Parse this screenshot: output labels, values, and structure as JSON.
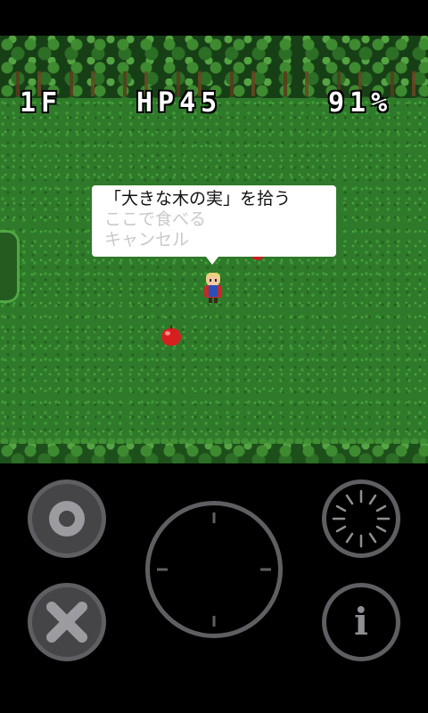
{
  "hud": {
    "floor": "1F",
    "hp": "HP45",
    "fullness": "91%"
  },
  "menu": {
    "items": [
      {
        "label": "「大きな木の実」を拾う",
        "enabled": true
      },
      {
        "label": "ここで食べる",
        "enabled": false
      },
      {
        "label": "キャンセル",
        "enabled": false
      }
    ]
  },
  "controls": {
    "ok_icon": "circle-icon",
    "cancel_icon": "x-icon",
    "wait_icon": "clock-dial-icon",
    "info_label": "i",
    "dpad_icon": "directional-pad-icon"
  },
  "colors": {
    "grass": "#2f7a2a",
    "menu_text": "#111111",
    "menu_disabled": "#c9c9c9",
    "button_gray": "#5f5f63"
  }
}
